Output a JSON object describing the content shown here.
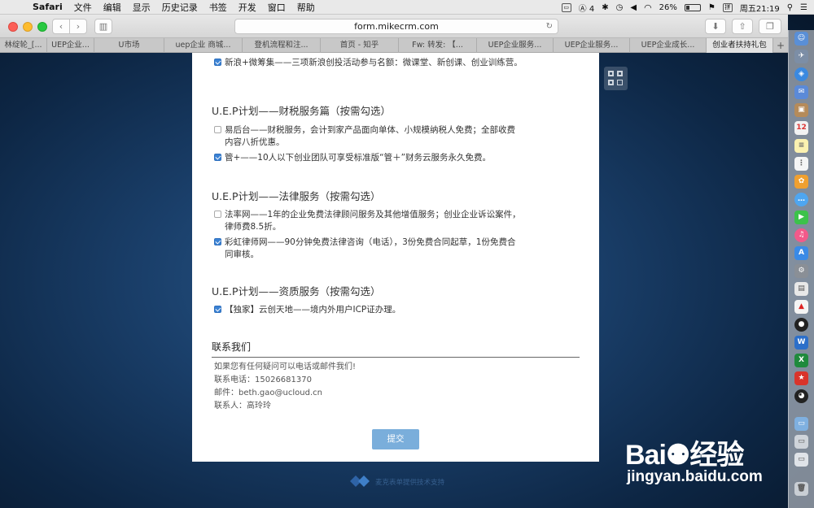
{
  "menubar": {
    "app": "Safari",
    "items": [
      "文件",
      "编辑",
      "显示",
      "历史记录",
      "书签",
      "开发",
      "窗口",
      "帮助"
    ],
    "status_count": "4",
    "battery": "26%",
    "clock": "周五21:19",
    "input_method": "拼"
  },
  "toolbar": {
    "url": "form.mikecrm.com"
  },
  "tabs": [
    {
      "label": "林绽轮_[..."
    },
    {
      "label": "UEP企业..."
    },
    {
      "label": "U市场"
    },
    {
      "label": "uep企业 商城..."
    },
    {
      "label": "登机流程和注..."
    },
    {
      "label": "首页 - 知乎"
    },
    {
      "label": "Fw: 转发: 【..."
    },
    {
      "label": "UEP企业服务..."
    },
    {
      "label": "UEP企业服务..."
    },
    {
      "label": "UEP企业成长..."
    },
    {
      "label": "创业者扶持礼包"
    }
  ],
  "form": {
    "top_option": {
      "text": "新浪+微筹集——三项新浪创投活动参与名额：微课堂、新创课、创业训练营。",
      "checked": true
    },
    "sections": [
      {
        "title": "U.E.P计划——财税服务篇（按需勾选）",
        "options": [
          {
            "text": "易后台——财税服务，会计到家产品面向单体、小规模纳税人免费；全部收费内容八折优惠。",
            "checked": false
          },
          {
            "text": "管+——10人以下创业团队可享受标准版“管＋”财务云服务永久免费。",
            "checked": true
          }
        ]
      },
      {
        "title": "U.E.P计划——法律服务（按需勾选）",
        "options": [
          {
            "text": "法率网——1年的企业免费法律顾问服务及其他增值服务；创业企业诉讼案件，律师费8.5折。",
            "checked": false
          },
          {
            "text": "彩虹律师网——90分钟免费法律咨询（电话），3份免费合同起草，1份免费合同审核。",
            "checked": true
          }
        ]
      },
      {
        "title": "U.E.P计划——资质服务（按需勾选）",
        "options": [
          {
            "text": "【独家】云创天地——境内外用户ICP证办理。",
            "checked": true
          }
        ]
      }
    ],
    "contact": {
      "title": "联系我们",
      "lines": [
        "如果您有任何疑问可以电话或邮件我们!",
        "联系电话：15026681370",
        "邮件：beth.gao@ucloud.cn",
        "联系人：高玲玲"
      ]
    },
    "submit_label": "提交"
  },
  "footer": {
    "text": "麦克表单提供技术支持"
  },
  "watermark": {
    "brand": "Bai",
    "brand_suffix": "经验",
    "url": "jingyan.baidu.com"
  },
  "colors": {
    "accent": "#3b82d4",
    "submit": "#7aaedb"
  }
}
